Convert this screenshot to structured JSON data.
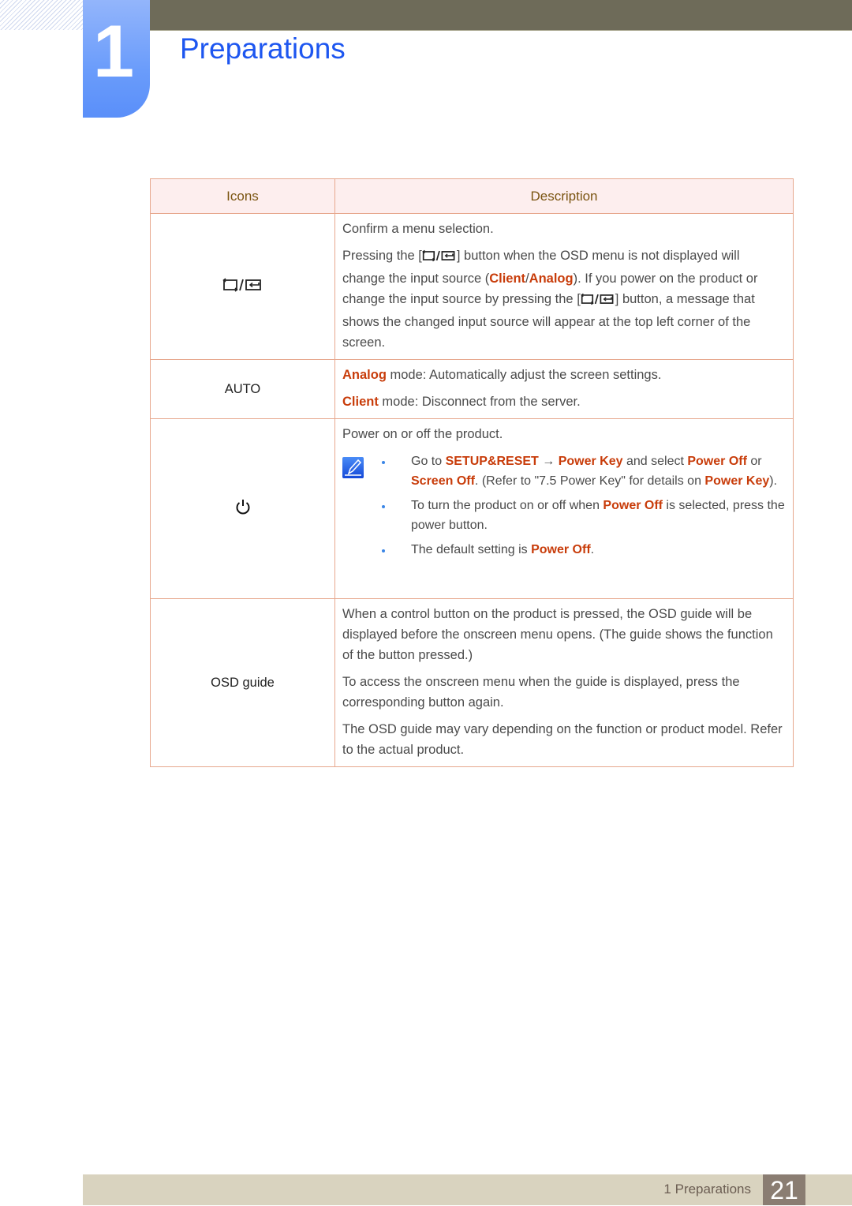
{
  "header": {
    "chapter_number": "1",
    "title": "Preparations"
  },
  "table": {
    "columns": [
      "Icons",
      "Description"
    ],
    "rows": [
      {
        "icon": "source-enter-icon",
        "desc": {
          "p1": "Confirm a menu selection.",
          "p2_a": "Pressing the [",
          "p2_b": "] button when the OSD menu is not displayed will change the input source (",
          "p2_client": "Client",
          "p2_sep": "/",
          "p2_analog": "Analog",
          "p2_c": "). If you power on the product or change the input source by pressing the [",
          "p2_d": "] button, a message that shows the changed input source will appear at the top left corner of the screen."
        }
      },
      {
        "icon_label": "AUTO",
        "desc": {
          "l1_hl": "Analog",
          "l1": " mode: Automatically adjust the screen settings.",
          "l2_hl": "Client",
          "l2": " mode: Disconnect from the server."
        }
      },
      {
        "icon": "power-icon",
        "desc": {
          "p1": "Power on or off the product.",
          "note_icon": "note-pencil-icon",
          "b1_a": "Go to ",
          "b1_setup": "SETUP&RESET",
          "b1_arrow": " → ",
          "b1_powerkey": "Power Key",
          "b1_b": " and select ",
          "b1_poweroff": "Power Off",
          "b1_c": " or ",
          "b1_screenoff": "Screen Off",
          "b1_d": ". (Refer to \"7.5 Power Key\" for details on ",
          "b1_powerkey2": "Power Key",
          "b1_e": ").",
          "b2_a": "To turn the product on or off when ",
          "b2_poweroff": "Power Off",
          "b2_b": " is selected, press the power button.",
          "b3_a": "The default setting is ",
          "b3_poweroff": "Power Off",
          "b3_b": "."
        }
      },
      {
        "icon_label": "OSD guide",
        "desc": {
          "p1": "When a control button on the product is pressed, the OSD guide will be displayed before the onscreen menu opens. (The guide shows the function of the button pressed.)",
          "p2": "To access the onscreen menu when the guide is displayed, press the corresponding button again.",
          "p3": "The OSD guide may vary depending on the function or product model. Refer to the actual product."
        }
      }
    ]
  },
  "footer": {
    "section_label": "1 Preparations",
    "page_number": "21"
  },
  "colors": {
    "title_blue": "#1d56f0",
    "highlight": "#c83c0a",
    "header_text": "#7a5410",
    "header_bg": "#fdeeee",
    "topbar": "#6e6b59",
    "footer_bg": "#d9d3bf",
    "page_box": "#8a7d72"
  }
}
